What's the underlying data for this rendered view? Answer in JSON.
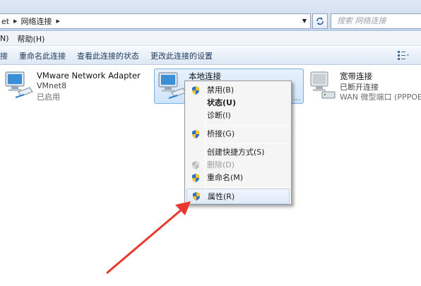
{
  "address_bar": {
    "crumb_cut": "et",
    "crumb_current": "网络连接",
    "search_placeholder": "搜索 网络连接"
  },
  "menu": {
    "items": [
      "N)",
      "帮助(H)"
    ]
  },
  "command_bar": {
    "items": [
      "接",
      "重命名此连接",
      "查看此连接的状态",
      "更改此连接的设置"
    ]
  },
  "adapters": [
    {
      "name": "VMware Network Adapter",
      "detail": "VMnet8",
      "status": "已启用"
    },
    {
      "name": "本地连接",
      "detail": "",
      "status": ""
    },
    {
      "name": "宽带连接",
      "detail": "已断开连接",
      "status": "WAN 微型端口 (PPPOE)"
    }
  ],
  "context_menu": {
    "items": [
      {
        "label": "禁用(B)",
        "shield": true
      },
      {
        "label": "状态(U)",
        "bold": true
      },
      {
        "label": "诊断(I)"
      },
      {
        "label": "桥接(G)",
        "shield": true
      },
      {
        "label": "创建快捷方式(S)"
      },
      {
        "label": "删除(D)",
        "shield": true,
        "disabled": true
      },
      {
        "label": "重命名(M)",
        "shield": true
      },
      {
        "label": "属性(R)",
        "shield": true,
        "hover": true
      }
    ]
  },
  "colors": {
    "accent": "#2b5fa8",
    "arrow": "#e8392c",
    "selection": "#cfe4fb"
  }
}
